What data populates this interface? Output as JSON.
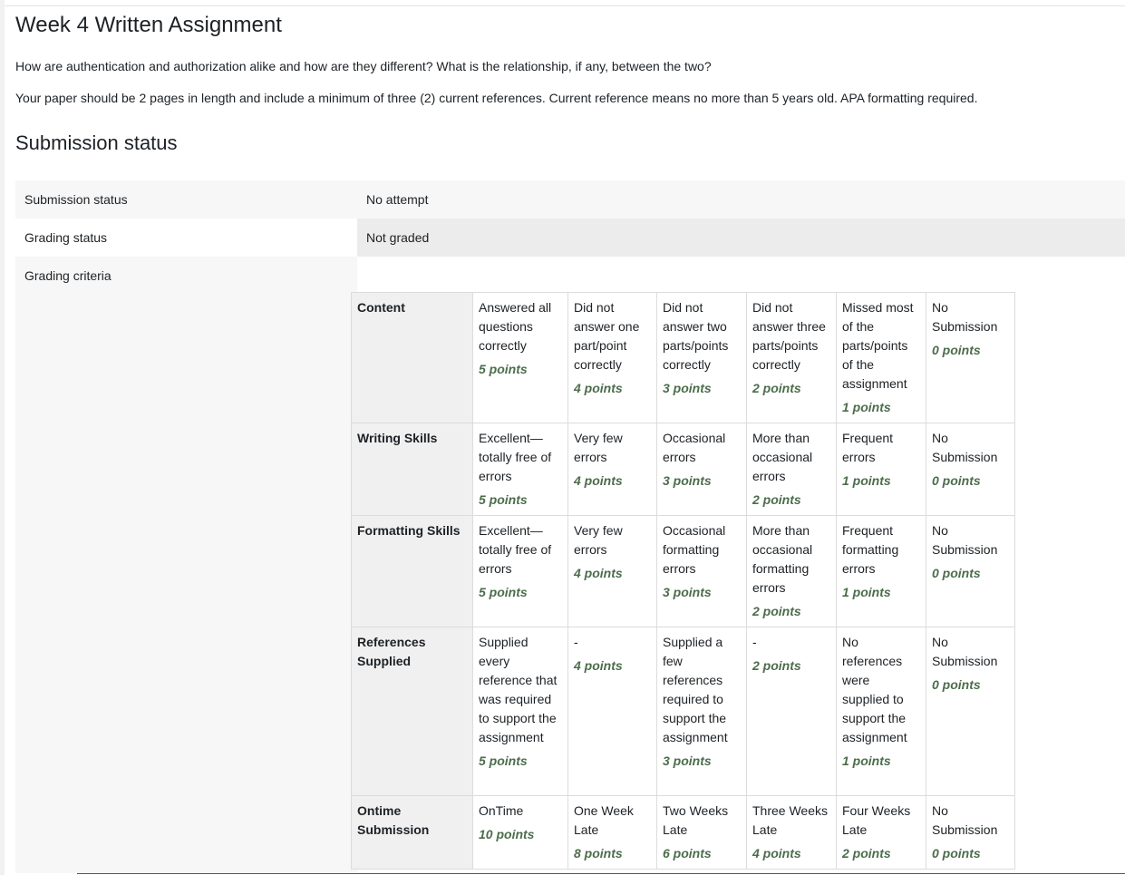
{
  "page": {
    "title": "Week 4 Written Assignment",
    "question": "How are authentication and authorization alike and how are they different? What is the relationship, if any, between the two?",
    "instructions": "Your paper should be 2 pages in length and include a minimum of three (2) current references. Current reference means no more than 5 years old.  APA formatting required."
  },
  "submission": {
    "heading": "Submission status",
    "rows": [
      {
        "label": "Submission status",
        "value": "No attempt"
      },
      {
        "label": "Grading status",
        "value": "Not graded"
      },
      {
        "label": "Grading criteria",
        "value": ""
      }
    ]
  },
  "rubric": {
    "criteria": [
      {
        "name": "Content",
        "levels": [
          {
            "desc": "Answered all questions correctly",
            "points": "5 points"
          },
          {
            "desc": "Did not answer one part/point correctly",
            "points": "4 points"
          },
          {
            "desc": "Did not answer two parts/points correctly",
            "points": "3 points"
          },
          {
            "desc": "Did not answer three parts/points correctly",
            "points": "2 points"
          },
          {
            "desc": "Missed most of the parts/points of the assignment",
            "points": "1 points"
          },
          {
            "desc": "No Submission",
            "points": "0 points"
          }
        ]
      },
      {
        "name": "Writing Skills",
        "levels": [
          {
            "desc": "Excellent—totally free of errors",
            "points": "5 points"
          },
          {
            "desc": "Very few errors",
            "points": "4 points"
          },
          {
            "desc": "Occasional errors",
            "points": "3 points"
          },
          {
            "desc": "More than occasional errors",
            "points": "2 points"
          },
          {
            "desc": "Frequent errors",
            "points": "1 points"
          },
          {
            "desc": "No Submission",
            "points": "0 points"
          }
        ]
      },
      {
        "name": "Formatting Skills",
        "levels": [
          {
            "desc": "Excellent—totally free of errors",
            "points": "5 points"
          },
          {
            "desc": "Very few errors",
            "points": "4 points"
          },
          {
            "desc": "Occasional formatting errors",
            "points": "3 points"
          },
          {
            "desc": "More than occasional formatting errors",
            "points": "2 points"
          },
          {
            "desc": "Frequent formatting errors",
            "points": "1 points"
          },
          {
            "desc": "No Submission",
            "points": "0 points"
          }
        ]
      },
      {
        "name": "References Supplied",
        "levels": [
          {
            "desc": "Supplied every reference that was required to support the assignment",
            "points": "5 points"
          },
          {
            "desc": "-",
            "points": "4 points"
          },
          {
            "desc": "Supplied a few references required to support the assignment",
            "points": "3 points"
          },
          {
            "desc": "-",
            "points": "2 points"
          },
          {
            "desc": "No references were supplied to support the assignment",
            "points": "1 points"
          },
          {
            "desc": "No Submission",
            "points": "0 points"
          }
        ]
      },
      {
        "name": "Ontime Submission",
        "levels": [
          {
            "desc": "OnTime",
            "points": "10 points"
          },
          {
            "desc": "One Week Late",
            "points": "8 points"
          },
          {
            "desc": "Two Weeks Late",
            "points": "6 points"
          },
          {
            "desc": "Three Weeks Late",
            "points": "4 points"
          },
          {
            "desc": "Four Weeks Late",
            "points": "2 points"
          },
          {
            "desc": "No Submission",
            "points": "0 points"
          }
        ]
      }
    ],
    "colors": {
      "points": "#4c6d4c",
      "criterion_bg": "#f0f0f0",
      "border": "#dcdcdc"
    }
  }
}
